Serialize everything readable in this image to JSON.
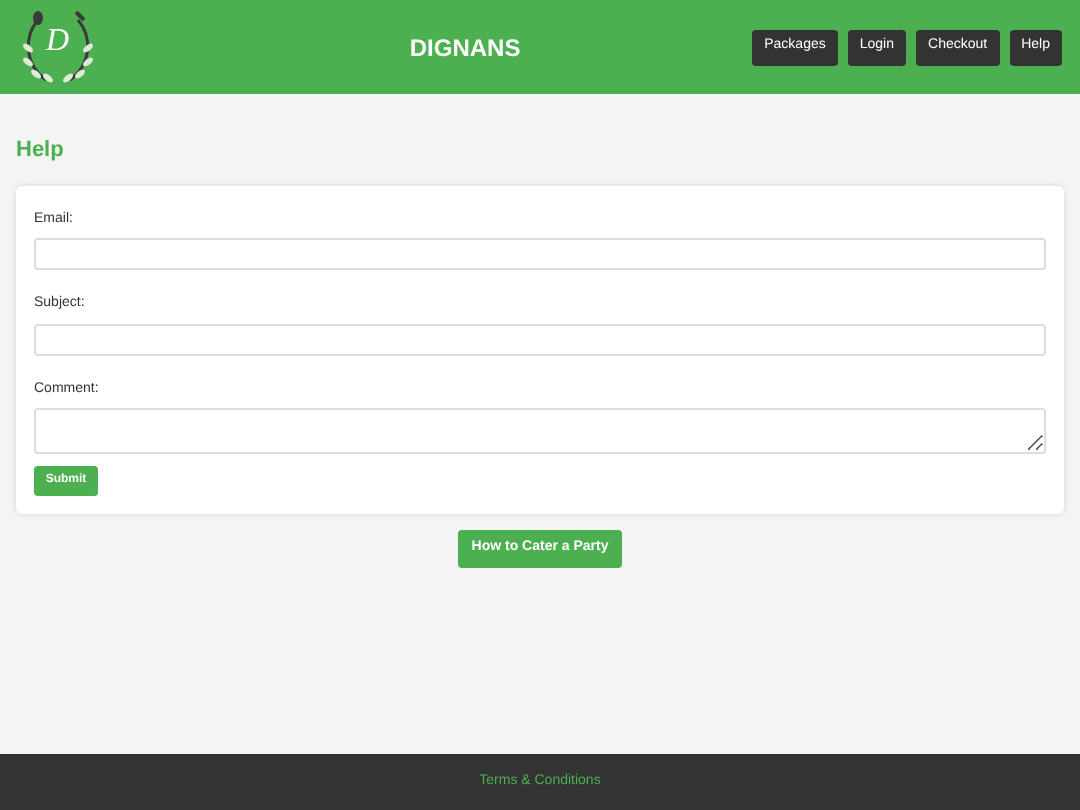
{
  "header": {
    "logo_letter": "D",
    "title": "DIGNANS",
    "nav": [
      {
        "label": "Packages"
      },
      {
        "label": "Login"
      },
      {
        "label": "Checkout"
      },
      {
        "label": "Help"
      }
    ]
  },
  "page_title": "Help",
  "form": {
    "fields": [
      {
        "label": "Email:",
        "kind": "input"
      },
      {
        "label": "Subject:",
        "kind": "input"
      },
      {
        "label": "Comment:",
        "kind": "textarea"
      }
    ],
    "submit": "Submit"
  },
  "link_button": "How to Cater a Party",
  "footer": {
    "link": "Terms & Conditions"
  }
}
